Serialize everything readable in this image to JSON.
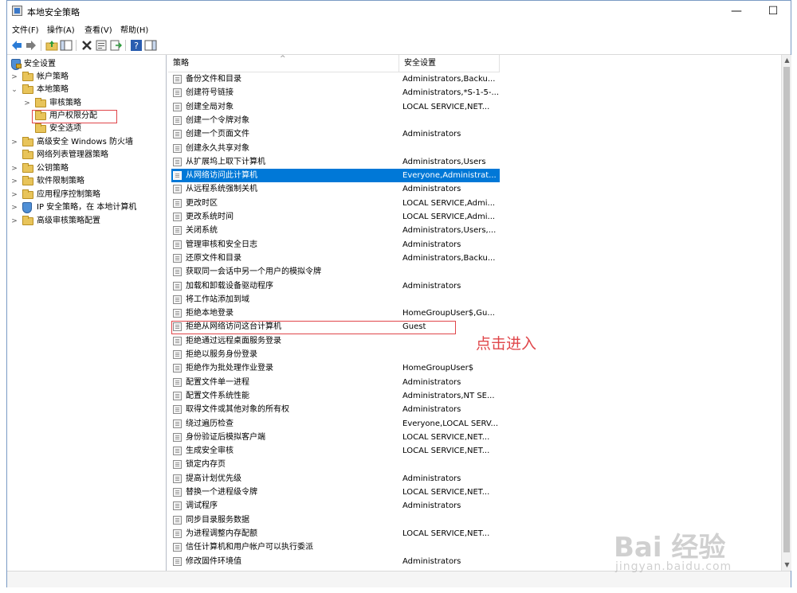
{
  "window": {
    "title": "本地安全策略",
    "minimize": "—",
    "maximize": "☐",
    "close": "✕"
  },
  "menu": [
    "文件(F)",
    "操作(A)",
    "查看(V)",
    "帮助(H)"
  ],
  "tree": [
    {
      "label": "安全设置",
      "depth": 0,
      "chevron": "",
      "icon": "shield-lock"
    },
    {
      "label": "帐户策略",
      "depth": 1,
      "chevron": ">",
      "icon": "folder"
    },
    {
      "label": "本地策略",
      "depth": 1,
      "chevron": "v",
      "icon": "folder"
    },
    {
      "label": "审核策略",
      "depth": 2,
      "chevron": ">",
      "icon": "folder"
    },
    {
      "label": "用户权限分配",
      "depth": 2,
      "chevron": "",
      "icon": "folder",
      "selected": true
    },
    {
      "label": "安全选项",
      "depth": 2,
      "chevron": "",
      "icon": "folder"
    },
    {
      "label": "高级安全 Windows 防火墙",
      "depth": 1,
      "chevron": ">",
      "icon": "folder"
    },
    {
      "label": "网络列表管理器策略",
      "depth": 1,
      "chevron": "",
      "icon": "folder"
    },
    {
      "label": "公钥策略",
      "depth": 1,
      "chevron": ">",
      "icon": "folder"
    },
    {
      "label": "软件限制策略",
      "depth": 1,
      "chevron": ">",
      "icon": "folder"
    },
    {
      "label": "应用程序控制策略",
      "depth": 1,
      "chevron": ">",
      "icon": "folder"
    },
    {
      "label": "IP 安全策略，在 本地计算机",
      "depth": 1,
      "chevron": ">",
      "icon": "ip-shield"
    },
    {
      "label": "高级审核策略配置",
      "depth": 1,
      "chevron": ">",
      "icon": "folder"
    }
  ],
  "columns": {
    "policy": "策略",
    "setting": "安全设置"
  },
  "rows": [
    {
      "name": "备份文件和目录",
      "setting": "Administrators,Backu..."
    },
    {
      "name": "创建符号链接",
      "setting": "Administrators,*S-1-5-..."
    },
    {
      "name": "创建全局对象",
      "setting": "LOCAL SERVICE,NET..."
    },
    {
      "name": "创建一个令牌对象",
      "setting": ""
    },
    {
      "name": "创建一个页面文件",
      "setting": "Administrators"
    },
    {
      "name": "创建永久共享对象",
      "setting": ""
    },
    {
      "name": "从扩展坞上取下计算机",
      "setting": "Administrators,Users"
    },
    {
      "name": "从网络访问此计算机",
      "setting": "Everyone,Administrat...",
      "selected": true
    },
    {
      "name": "从远程系统强制关机",
      "setting": "Administrators"
    },
    {
      "name": "更改时区",
      "setting": "LOCAL SERVICE,Admi..."
    },
    {
      "name": "更改系统时间",
      "setting": "LOCAL SERVICE,Admi..."
    },
    {
      "name": "关闭系统",
      "setting": "Administrators,Users,..."
    },
    {
      "name": "管理审核和安全日志",
      "setting": "Administrators"
    },
    {
      "name": "还原文件和目录",
      "setting": "Administrators,Backu..."
    },
    {
      "name": "获取同一会话中另一个用户的模拟令牌",
      "setting": ""
    },
    {
      "name": "加载和卸载设备驱动程序",
      "setting": "Administrators"
    },
    {
      "name": "将工作站添加到域",
      "setting": ""
    },
    {
      "name": "拒绝本地登录",
      "setting": "HomeGroupUser$,Gu..."
    },
    {
      "name": "拒绝从网络访问这台计算机",
      "setting": "Guest"
    },
    {
      "name": "拒绝通过远程桌面服务登录",
      "setting": ""
    },
    {
      "name": "拒绝以服务身份登录",
      "setting": ""
    },
    {
      "name": "拒绝作为批处理作业登录",
      "setting": "HomeGroupUser$"
    },
    {
      "name": "配置文件单一进程",
      "setting": "Administrators"
    },
    {
      "name": "配置文件系统性能",
      "setting": "Administrators,NT SE..."
    },
    {
      "name": "取得文件或其他对象的所有权",
      "setting": "Administrators"
    },
    {
      "name": "绕过遍历检查",
      "setting": "Everyone,LOCAL SERV..."
    },
    {
      "name": "身份验证后模拟客户端",
      "setting": "LOCAL SERVICE,NET..."
    },
    {
      "name": "生成安全审核",
      "setting": "LOCAL SERVICE,NET..."
    },
    {
      "name": "锁定内存页",
      "setting": ""
    },
    {
      "name": "提高计划优先级",
      "setting": "Administrators"
    },
    {
      "name": "替换一个进程级令牌",
      "setting": "LOCAL SERVICE,NET..."
    },
    {
      "name": "调试程序",
      "setting": "Administrators"
    },
    {
      "name": "同步目录服务数据",
      "setting": ""
    },
    {
      "name": "为进程调整内存配额",
      "setting": "LOCAL SERVICE,NET..."
    },
    {
      "name": "信任计算机和用户帐户可以执行委派",
      "setting": ""
    },
    {
      "name": "修改固件环境值",
      "setting": "Administrators"
    }
  ],
  "annotation": "点击进入",
  "watermark": {
    "logo": "Bai 经验",
    "url": "jingyan.baidu.com"
  },
  "colors": {
    "selection": "#0078d7",
    "annotation": "#e0464a"
  }
}
